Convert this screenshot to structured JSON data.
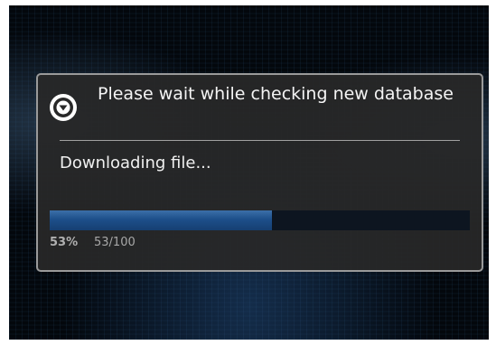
{
  "dialog": {
    "icon": "info-arrow-icon",
    "title": "Please wait while checking new database",
    "message": "Downloading file...",
    "progress": {
      "value": 53,
      "max": 100,
      "percent_label": "53%",
      "count_label": "53/100"
    }
  },
  "colors": {
    "dialog_background": "#282828",
    "dialog_border": "#9a9a9a",
    "progress_fill": "#1d4f8a",
    "progress_track": "#0d1520",
    "text_primary": "#f4f4f4"
  }
}
